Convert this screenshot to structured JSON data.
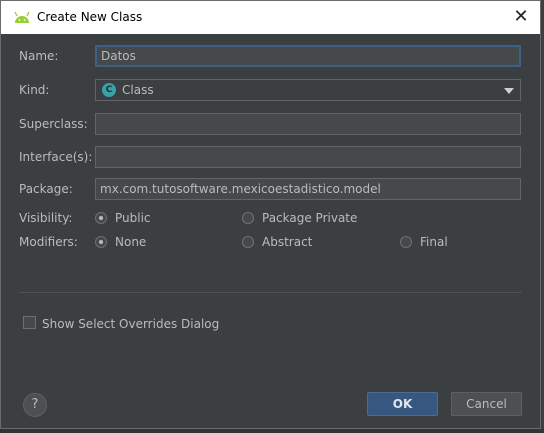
{
  "dialog": {
    "title": "Create New Class",
    "icon": "android-icon",
    "close_icon": "close-icon"
  },
  "form": {
    "name": {
      "label": "Name:",
      "value": "Datos"
    },
    "kind": {
      "label": "Kind:",
      "value": "Class",
      "badge": "C"
    },
    "superclass": {
      "label": "Superclass:",
      "value": ""
    },
    "interfaces": {
      "label": "Interface(s):",
      "value": ""
    },
    "package": {
      "label": "Package:",
      "value": "mx.com.tutosoftware.mexicoestadistico.model"
    },
    "visibility": {
      "label": "Visibility:",
      "options": [
        {
          "label": "Public",
          "checked": true
        },
        {
          "label": "Package Private",
          "checked": false
        }
      ]
    },
    "modifiers": {
      "label": "Modifiers:",
      "options": [
        {
          "label": "None",
          "checked": true
        },
        {
          "label": "Abstract",
          "checked": false
        },
        {
          "label": "Final",
          "checked": false
        }
      ]
    },
    "show_overrides": {
      "label": "Show Select Overrides Dialog",
      "checked": false
    }
  },
  "buttons": {
    "help": "?",
    "ok": "OK",
    "cancel": "Cancel"
  },
  "colors": {
    "background": "#3c3f41",
    "accent": "#365880",
    "focus": "#3d6185",
    "kind_badge": "#3ba0a8"
  }
}
